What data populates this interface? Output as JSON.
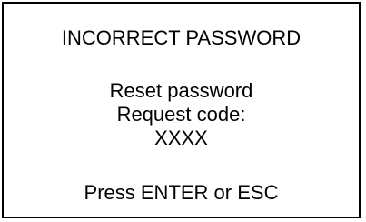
{
  "dialog": {
    "title": "INCORRECT PASSWORD",
    "reset_label": "Reset password",
    "request_code_label": "Request code:",
    "request_code_value": "XXXX",
    "prompt": "Press ENTER or ESC"
  },
  "colors": {
    "background": "#ffffff",
    "border": "#000000",
    "text": "#000000"
  }
}
